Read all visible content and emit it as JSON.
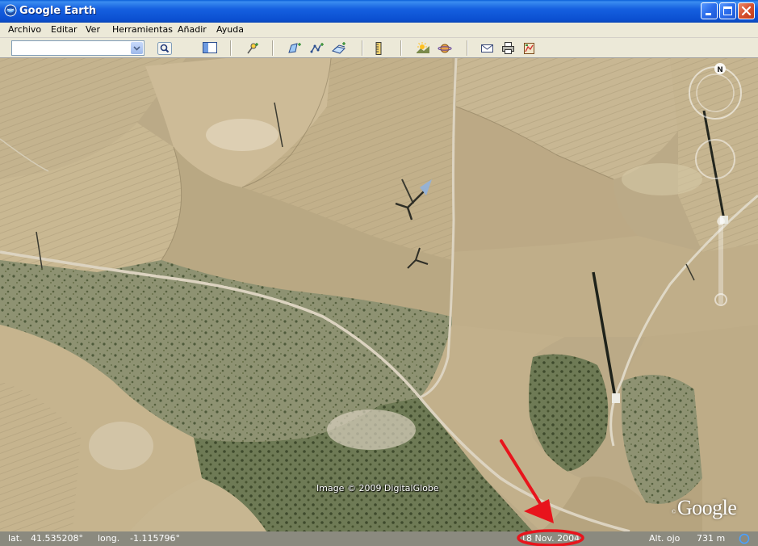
{
  "window": {
    "title": "Google Earth"
  },
  "menu": {
    "items": [
      "Archivo",
      "Editar",
      "Ver",
      "Herramientas",
      "Añadir",
      "Ayuda"
    ]
  },
  "toolbar": {
    "search": {
      "value": "",
      "placeholder": ""
    },
    "buttons": [
      "search-icon",
      "sidebar-toggle-icon",
      "placemark-icon",
      "polygon-icon",
      "path-icon",
      "image-overlay-icon",
      "ruler-icon",
      "sunlight-icon",
      "planets-icon",
      "email-icon",
      "print-icon",
      "view-in-maps-icon"
    ]
  },
  "map": {
    "attribution": "Image © 2009 DigitalGlobe",
    "logo": "Google",
    "compass_label": "N"
  },
  "status": {
    "lat_label": "lat.",
    "lat_value": "41.535208°",
    "lon_label": "long.",
    "lon_value": "-1.115796°",
    "imagery_date": "18 Nov. 2004",
    "alt_label": "Alt. ojo",
    "alt_value": "731 m"
  },
  "annotation": {
    "color": "#E8141C"
  }
}
